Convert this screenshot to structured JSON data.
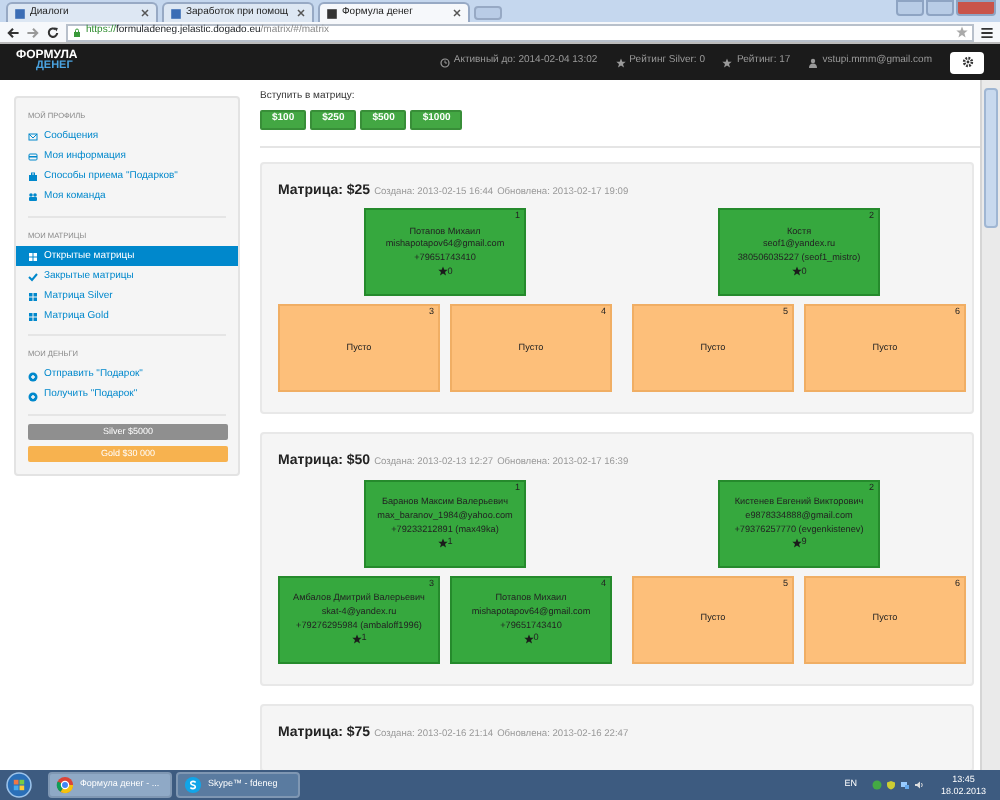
{
  "browser": {
    "tabs": [
      {
        "label": "Диалоги",
        "selected": false
      },
      {
        "label": "Заработок при помощ",
        "selected": false
      },
      {
        "label": "Формула денег",
        "selected": true
      }
    ],
    "url": {
      "scheme": "https://",
      "host": "formuladeneg.jelastic.dogado.eu",
      "path": "/matrix/#/matrix"
    }
  },
  "navbar": {
    "logo_top": "ФОРМУЛА",
    "logo_bottom": "ДЕНЕГ",
    "items": [
      {
        "kind": "clock",
        "text": "Активный до: 2014-02-04 13:02"
      },
      {
        "kind": "star",
        "text": "Рейтинг Silver: 0"
      },
      {
        "kind": "star",
        "text": "Рейтинг: 17"
      },
      {
        "kind": "user",
        "text": "vstupi.mmm@gmail.com"
      }
    ]
  },
  "sidebar": {
    "sections": [
      {
        "header": "МОЙ ПРОФИЛЬ",
        "items": [
          {
            "kind": "envelope",
            "label": "Сообщения",
            "selected": false
          },
          {
            "kind": "card",
            "label": "Моя информация",
            "selected": false
          },
          {
            "kind": "briefcase",
            "label": "Способы приема \"Подарков\"",
            "selected": false
          },
          {
            "kind": "team",
            "label": "Моя команда",
            "selected": false
          }
        ]
      },
      {
        "header": "МОИ МАТРИЦЫ",
        "items": [
          {
            "kind": "grid",
            "label": "Открытые матрицы",
            "selected": true
          },
          {
            "kind": "check",
            "label": "Закрытые матрицы",
            "selected": false
          },
          {
            "kind": "grid",
            "label": "Матрица Silver",
            "selected": false
          },
          {
            "kind": "grid",
            "label": "Матрица Gold",
            "selected": false
          }
        ]
      },
      {
        "header": "МОИ ДЕНЬГИ",
        "items": [
          {
            "kind": "circle",
            "label": "Отправить \"Подарок\"",
            "selected": false
          },
          {
            "kind": "circle",
            "label": "Получить \"Подарок\"",
            "selected": false
          }
        ]
      }
    ],
    "buttons": [
      {
        "label": "Silver $5000",
        "disabled": true
      },
      {
        "label": "Gold $30 000",
        "disabled": false
      }
    ]
  },
  "join": {
    "label": "Вступить в матрицу:",
    "buttons": [
      "$100",
      "$250",
      "$500",
      "$1000"
    ]
  },
  "matrices": [
    {
      "title": "Матрица: $25",
      "created": "Создана: 2013-02-15 16:44",
      "updated": "Обновлена: 2013-02-17 19:09",
      "cells": [
        {
          "number": "1",
          "filled": true,
          "lines": [
            "Потапов Михаил",
            "mishapotapov64@gmail.com",
            "+79651743410"
          ],
          "rating": "0"
        },
        {
          "number": "2",
          "filled": true,
          "lines": [
            "Костя",
            "seof1@yandex.ru",
            "380506035227 (seof1_mistro)"
          ],
          "rating": "0"
        },
        {
          "number": "3",
          "filled": false,
          "text": "Пусто"
        },
        {
          "number": "4",
          "filled": false,
          "text": "Пусто"
        },
        {
          "number": "5",
          "filled": false,
          "text": "Пусто"
        },
        {
          "number": "6",
          "filled": false,
          "text": "Пусто"
        }
      ]
    },
    {
      "title": "Матрица: $50",
      "created": "Создана: 2013-02-13 12:27",
      "updated": "Обновлена: 2013-02-17 16:39",
      "cells": [
        {
          "number": "1",
          "filled": true,
          "lines": [
            "Баранов Максим Валерьевич",
            "max_baranov_1984@yahoo.com",
            "+79233212891 (max49ka)"
          ],
          "rating": "1"
        },
        {
          "number": "2",
          "filled": true,
          "lines": [
            "Кистенев Евгений Викторович",
            "e9878334888@gmail.com",
            "+79376257770 (evgenkistenev)"
          ],
          "rating": "9"
        },
        {
          "number": "3",
          "filled": true,
          "lines": [
            "Амбалов Дмитрий Валерьевич",
            "skat-4@yandex.ru",
            "+79276295984 (ambaloff1996)"
          ],
          "rating": "1"
        },
        {
          "number": "4",
          "filled": true,
          "lines": [
            "Потапов Михаил",
            "mishapotapov64@gmail.com",
            "+79651743410"
          ],
          "rating": "0"
        },
        {
          "number": "5",
          "filled": false,
          "text": "Пусто"
        },
        {
          "number": "6",
          "filled": false,
          "text": "Пусто"
        }
      ]
    },
    {
      "title": "Матрица: $75",
      "created": "Создана: 2013-02-16 21:14",
      "updated": "Обновлена: 2013-02-16 22:47"
    }
  ],
  "taskbar": {
    "tasks": [
      {
        "kind": "chrome",
        "label": "Формула денег - ...",
        "selected": true
      },
      {
        "kind": "skype",
        "label": "Skype™ - fdeneg",
        "selected": false
      }
    ],
    "lang": "EN",
    "time": "13:45",
    "date": "18.02.2013"
  }
}
